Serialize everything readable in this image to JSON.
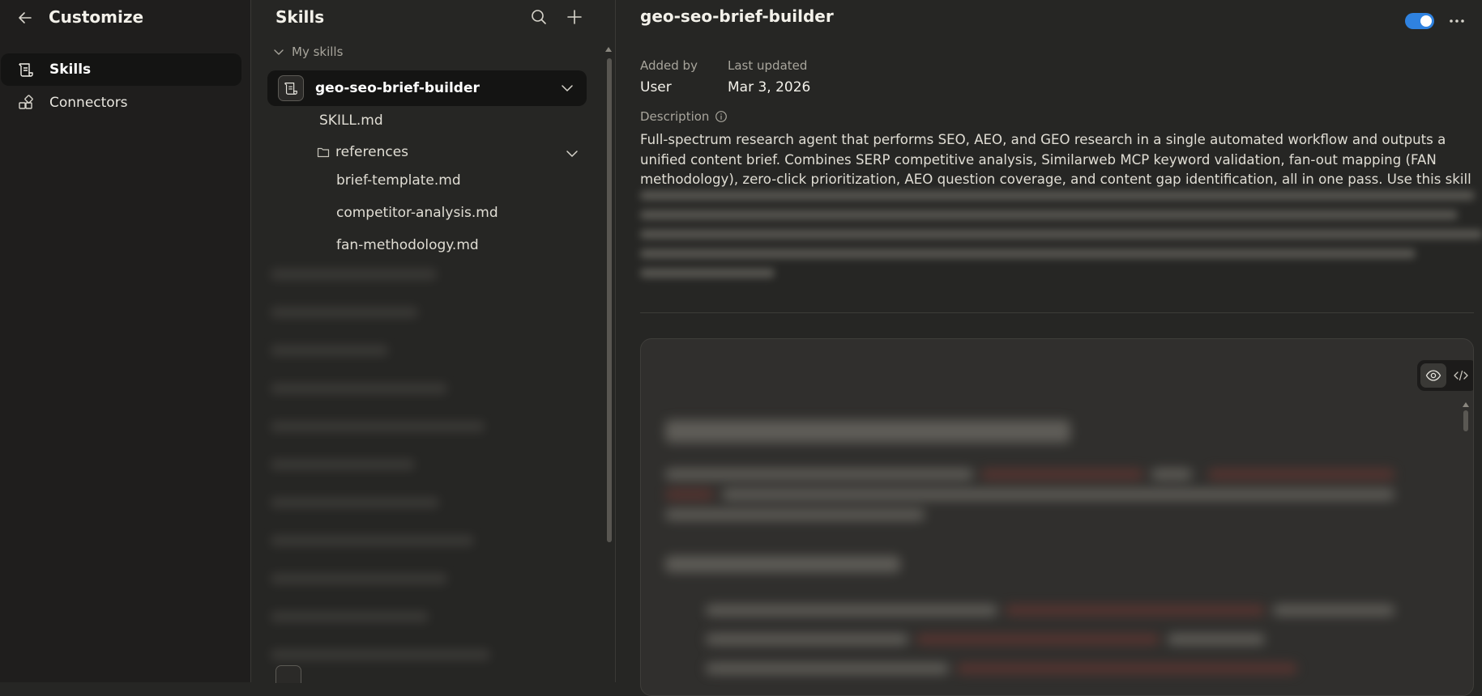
{
  "left": {
    "title": "Customize",
    "nav": [
      {
        "label": "Skills",
        "icon": "skills-icon",
        "active": true
      },
      {
        "label": "Connectors",
        "icon": "connectors-icon",
        "active": false
      }
    ]
  },
  "middle": {
    "title": "Skills",
    "section_label": "My skills",
    "selected_skill": "geo-seo-brief-builder",
    "files": {
      "skill_md": "SKILL.md",
      "folder": "references",
      "children": [
        "brief-template.md",
        "competitor-analysis.md",
        "fan-methodology.md"
      ]
    }
  },
  "detail": {
    "title": "geo-seo-brief-builder",
    "enabled": true,
    "added_by_label": "Added by",
    "added_by_value": "User",
    "last_updated_label": "Last updated",
    "last_updated_value": "Mar 3, 2026",
    "description_label": "Description",
    "description": "Full-spectrum research agent that performs SEO, AEO, and GEO research in a single automated workflow and outputs a unified content brief. Combines SERP competitive analysis, Similarweb MCP keyword validation, fan-out mapping (FAN methodology), zero-click prioritization, AEO question coverage, and content gap identification, all in one pass. Use this skill"
  },
  "colors": {
    "background": "#262624",
    "sidebar": "#1f1e1d",
    "selected": "#141413",
    "toggle_on": "#2f82e0",
    "text": "#e8e6df",
    "muted": "#a8a59c"
  }
}
